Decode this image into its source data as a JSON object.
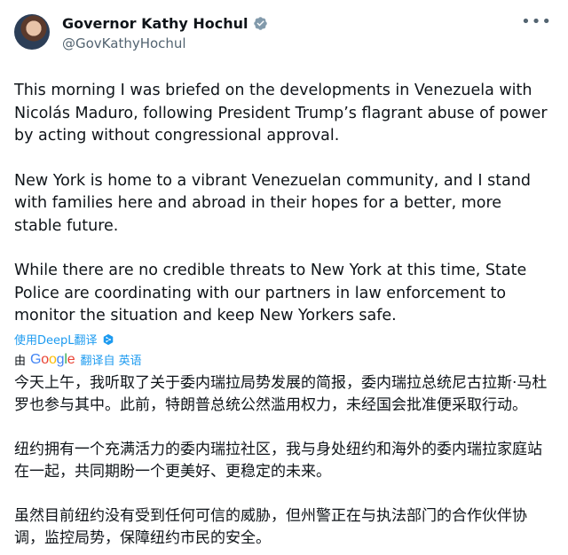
{
  "author": {
    "display_name": "Governor Kathy Hochul",
    "handle": "@GovKathyHochul",
    "verified": true,
    "verified_color": "#829aab"
  },
  "tweet": {
    "paragraphs": [
      "This morning I was briefed on the developments in Venezuela with Nicolás Maduro, following President Trump’s flagrant abuse of power by acting without congressional approval.",
      "New York is home to a vibrant Venezuelan community, and I stand with families here and abroad in their hopes for a better, more stable future.",
      "While there are no credible threats to New York at this time, State Police are coordinating with our partners in law enforcement to monitor the situation and keep New Yorkers safe."
    ]
  },
  "translation": {
    "deepl_link": "使用DeepL翻译",
    "by_label": "由",
    "provider": "Google",
    "translated_from": "翻译自 英语",
    "paragraphs": [
      "今天上午，我听取了关于委内瑞拉局势发展的简报，委内瑞拉总统尼古拉斯·马杜罗也参与其中。此前，特朗普总统公然滥用权力，未经国会批准便采取行动。",
      "纽约拥有一个充满活力的委内瑞拉社区，我与身处纽约和海外的委内瑞拉家庭站在一起，共同期盼一个更美好、更稳定的未来。",
      "虽然目前纽约没有受到任何可信的威胁，但州警正在与执法部门的合作伙伴协调，监控局势，保障纽约市民的安全。"
    ]
  },
  "icons": {
    "more": "more-options-icon",
    "verified": "verified-badge-icon",
    "deepl": "deepl-icon"
  },
  "colors": {
    "link": "#1d9bf0",
    "secondary_text": "#536471"
  }
}
